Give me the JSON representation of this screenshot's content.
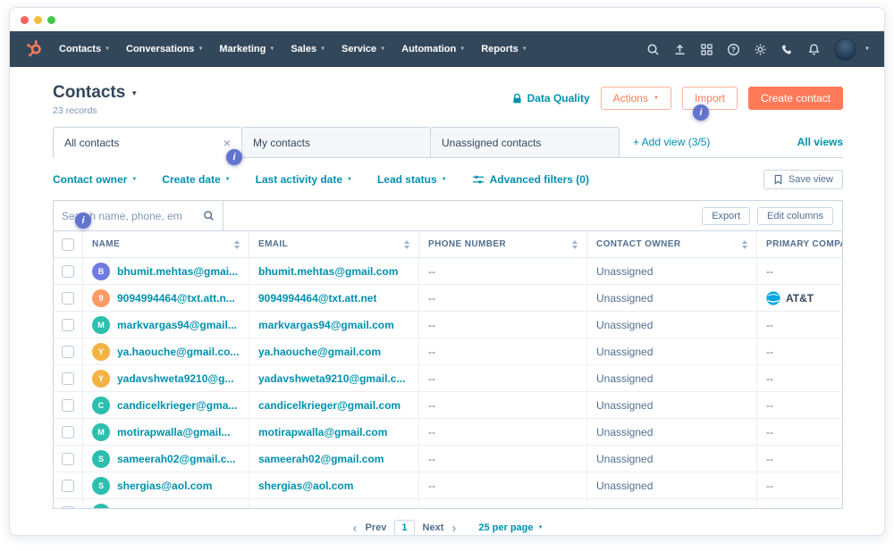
{
  "colors": {
    "brand_orange": "#ff7a59",
    "nav_background": "#33475b",
    "link_teal": "#0091ae",
    "coachmark_indigo": "#6274cf",
    "att_blue": "#00a8e0"
  },
  "titlebar": {
    "dot_colors": [
      "#f5655b",
      "#f6bd3b",
      "#43c645"
    ]
  },
  "navbar": {
    "items": [
      {
        "label": "Contacts"
      },
      {
        "label": "Conversations"
      },
      {
        "label": "Marketing"
      },
      {
        "label": "Sales"
      },
      {
        "label": "Service"
      },
      {
        "label": "Automation"
      },
      {
        "label": "Reports"
      }
    ],
    "icons": [
      "search-icon",
      "upload-icon",
      "marketplace-icon",
      "help-icon",
      "settings-icon",
      "phone-icon",
      "notifications-icon"
    ]
  },
  "header": {
    "title": "Contacts",
    "record_count": "23 records",
    "data_quality_label": "Data Quality",
    "actions_label": "Actions",
    "import_label": "Import",
    "create_contact_label": "Create contact"
  },
  "coachmarks": {
    "label": "i"
  },
  "views": {
    "tabs": [
      {
        "label": "All contacts",
        "active": true,
        "closable": true
      },
      {
        "label": "My contacts",
        "active": false,
        "closable": false
      },
      {
        "label": "Unassigned contacts",
        "active": false,
        "closable": false
      }
    ],
    "add_view_label": "+ Add view (3/5)",
    "all_views_label": "All views"
  },
  "filters": {
    "dropdowns": [
      "Contact owner",
      "Create date",
      "Last activity date",
      "Lead status"
    ],
    "advanced_label": "Advanced filters (0)",
    "save_view_label": "Save view"
  },
  "toolbar": {
    "search_placeholder": "Search name, phone, em",
    "export_label": "Export",
    "edit_columns_label": "Edit columns"
  },
  "table": {
    "columns": [
      "NAME",
      "EMAIL",
      "PHONE NUMBER",
      "CONTACT OWNER",
      "PRIMARY COMPANY"
    ],
    "rows": [
      {
        "initial": "B",
        "avatar_color": "#6f7ce3",
        "name": "bhumit.mehtas@gmai...",
        "email": "bhumit.mehtas@gmail.com",
        "phone": "--",
        "owner": "Unassigned",
        "company": "--"
      },
      {
        "initial": "9",
        "avatar_color": "#fb9b63",
        "name": "9094994464@txt.att.n...",
        "email": "9094994464@txt.att.net",
        "phone": "--",
        "owner": "Unassigned",
        "company": "AT&T",
        "company_logo": true
      },
      {
        "initial": "M",
        "avatar_color": "#2cbfae",
        "name": "markvargas94@gmail...",
        "email": "markvargas94@gmail.com",
        "phone": "--",
        "owner": "Unassigned",
        "company": "--"
      },
      {
        "initial": "Y",
        "avatar_color": "#f3b344",
        "name": "ya.haouche@gmail.co...",
        "email": "ya.haouche@gmail.com",
        "phone": "--",
        "owner": "Unassigned",
        "company": "--"
      },
      {
        "initial": "Y",
        "avatar_color": "#f3b344",
        "name": "yadavshweta9210@g...",
        "email": "yadavshweta9210@gmail.c...",
        "phone": "--",
        "owner": "Unassigned",
        "company": "--"
      },
      {
        "initial": "C",
        "avatar_color": "#2cbfae",
        "name": "candicelkrieger@gma...",
        "email": "candicelkrieger@gmail.com",
        "phone": "--",
        "owner": "Unassigned",
        "company": "--"
      },
      {
        "initial": "M",
        "avatar_color": "#2cbfae",
        "name": "motirapwalla@gmail...",
        "email": "motirapwalla@gmail.com",
        "phone": "--",
        "owner": "Unassigned",
        "company": "--"
      },
      {
        "initial": "S",
        "avatar_color": "#2cbfae",
        "name": "sameerah02@gmail.c...",
        "email": "sameerah02@gmail.com",
        "phone": "--",
        "owner": "Unassigned",
        "company": "--"
      },
      {
        "initial": "S",
        "avatar_color": "#2cbfae",
        "name": "shergias@aol.com",
        "email": "shergias@aol.com",
        "phone": "--",
        "owner": "Unassigned",
        "company": "--"
      },
      {
        "initial": "",
        "avatar_color": "#2cbfae",
        "name": "",
        "email": "",
        "phone": "",
        "owner": "",
        "company": ""
      }
    ]
  },
  "pagination": {
    "prev_label": "Prev",
    "current_page": "1",
    "next_label": "Next",
    "per_page_label": "25 per page"
  }
}
